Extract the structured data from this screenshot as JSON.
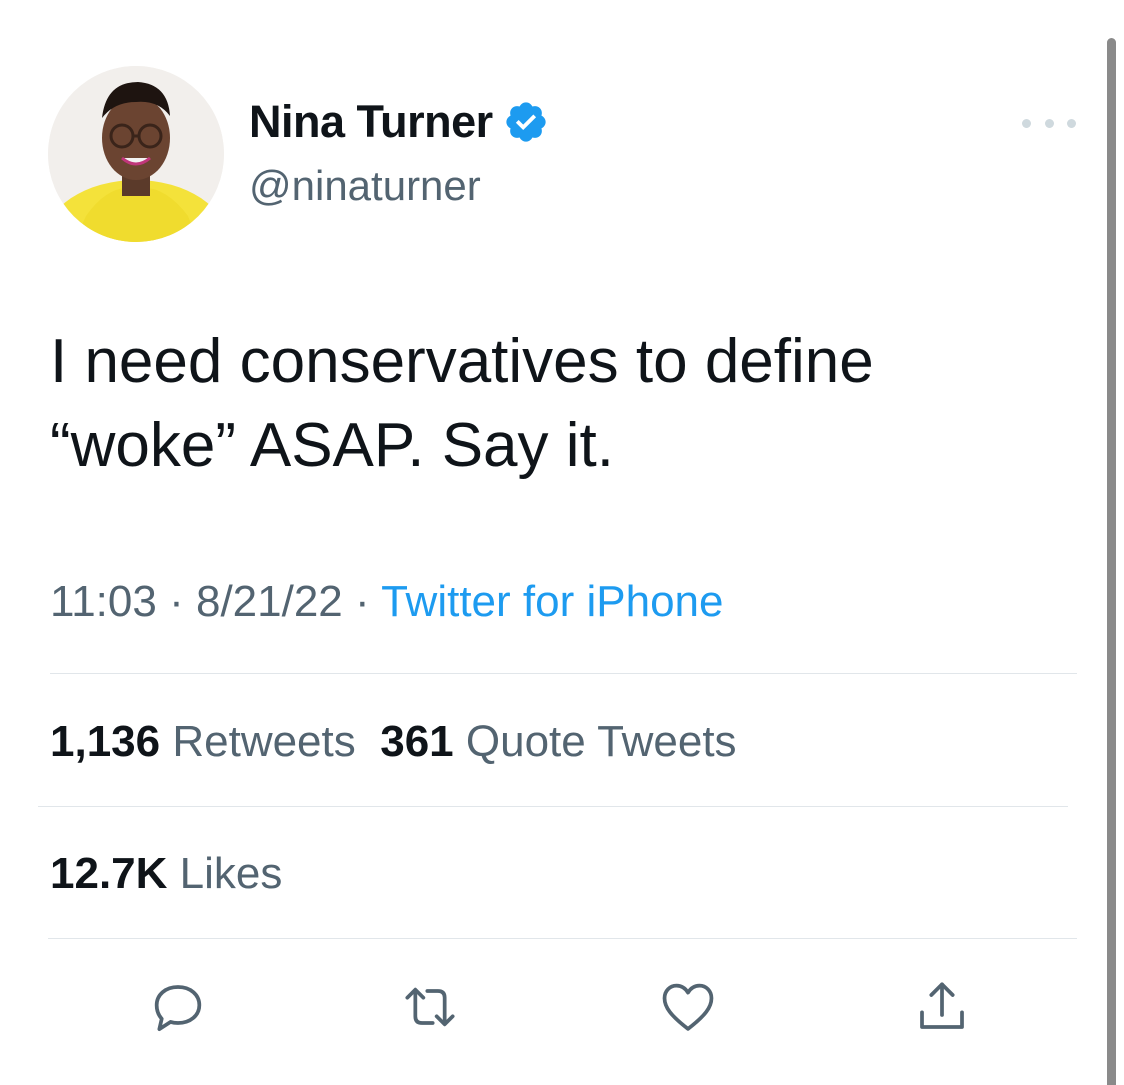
{
  "user": {
    "display_name": "Nina Turner",
    "handle": "@ninaturner",
    "verified": true
  },
  "tweet": {
    "text": "I need conservatives to define\n“woke” ASAP. Say it.",
    "time": "11:03",
    "date": "8/21/22",
    "separator": "·",
    "source": "Twitter for iPhone"
  },
  "stats": {
    "retweets_count": "1,136",
    "retweets_label": "Retweets",
    "quotes_count": "361",
    "quotes_label": "Quote Tweets",
    "likes_count": "12.7K",
    "likes_label": "Likes"
  },
  "icons": {
    "reply": "reply-icon",
    "retweet": "retweet-icon",
    "like": "heart-icon",
    "share": "share-icon",
    "more": "more-icon",
    "verified": "verified-badge-icon"
  },
  "colors": {
    "link": "#1d9bf0",
    "secondary_text": "#536471",
    "primary_text": "#0f1419",
    "verified_badge": "#1d9bf0"
  }
}
